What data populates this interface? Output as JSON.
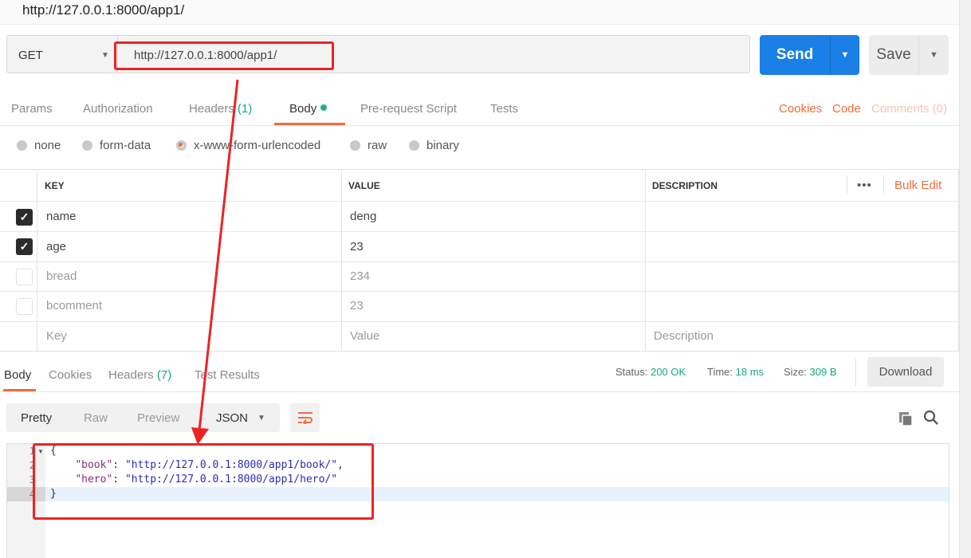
{
  "window": {
    "title": "http://127.0.0.1:8000/app1/"
  },
  "request": {
    "method": "GET",
    "url": "http://127.0.0.1:8000/app1/",
    "send_label": "Send",
    "save_label": "Save"
  },
  "request_tabs": {
    "params": "Params",
    "authorization": "Authorization",
    "headers": "Headers",
    "headers_count": "(1)",
    "body": "Body",
    "prerequest": "Pre-request Script",
    "tests": "Tests",
    "cookies": "Cookies",
    "code": "Code",
    "comments": "Comments (0)"
  },
  "body_types": {
    "none": "none",
    "form_data": "form-data",
    "urlencoded": "x-www-form-urlencoded",
    "raw": "raw",
    "binary": "binary",
    "selected": "x-www-form-urlencoded"
  },
  "params_table": {
    "headers": {
      "key": "KEY",
      "value": "VALUE",
      "description": "DESCRIPTION"
    },
    "bulk_edit": "Bulk Edit",
    "rows": [
      {
        "key": "name",
        "value": "deng",
        "enabled": true
      },
      {
        "key": "age",
        "value": "23",
        "enabled": true
      },
      {
        "key": "bread",
        "value": "234",
        "enabled": false
      },
      {
        "key": "bcomment",
        "value": "23",
        "enabled": false
      }
    ],
    "new_row": {
      "key_placeholder": "Key",
      "value_placeholder": "Value",
      "description_placeholder": "Description"
    }
  },
  "response": {
    "tabs": {
      "body": "Body",
      "cookies": "Cookies",
      "headers": "Headers",
      "headers_count": "(7)",
      "test_results": "Test Results"
    },
    "status_label": "Status:",
    "status_value": "200 OK",
    "time_label": "Time:",
    "time_value": "18 ms",
    "size_label": "Size:",
    "size_value": "309 B",
    "download_label": "Download",
    "formats": {
      "pretty": "Pretty",
      "raw": "Raw",
      "preview": "Preview",
      "json": "JSON"
    },
    "code_lines": {
      "n1": "1",
      "n2": "2",
      "n3": "3",
      "n4": "4",
      "l1": "{",
      "book_key": "\"book\"",
      "book_val": "\"http://127.0.0.1:8000/app1/book/\"",
      "hero_key": "\"hero\"",
      "hero_val": "\"http://127.0.0.1:8000/app1/hero/\"",
      "l4": "}"
    }
  },
  "colors": {
    "accent": "#f26b3a",
    "send": "#1a7fe6",
    "ok": "#16a589",
    "annotation": "#ec2324"
  },
  "icons": [
    "caret-down-icon",
    "checkbox-icon",
    "more-icon",
    "wrap-lines-icon",
    "copy-icon",
    "search-icon"
  ]
}
